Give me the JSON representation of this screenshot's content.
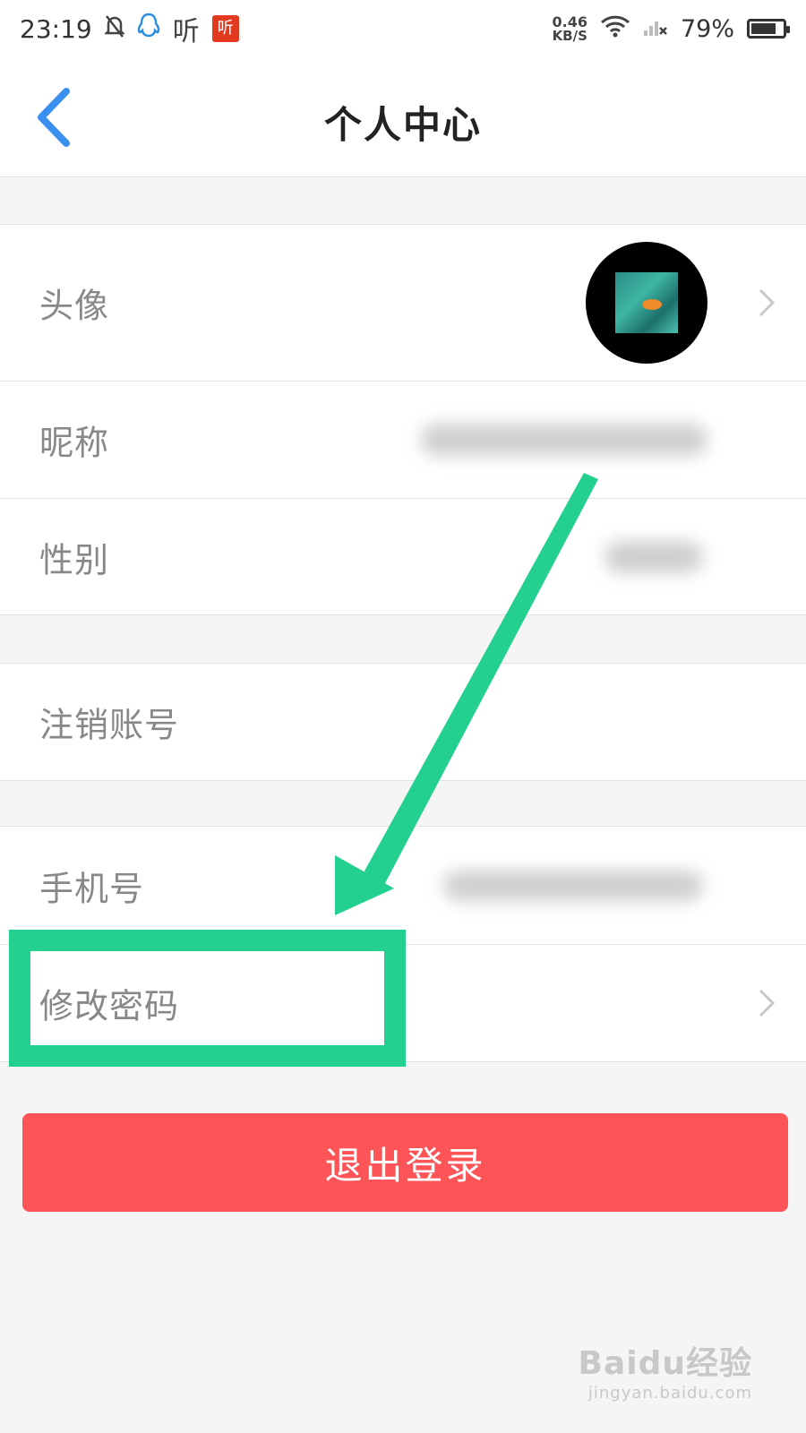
{
  "status_bar": {
    "time": "23:19",
    "ting_label": "听",
    "ting_badge": "听",
    "net_speed_value": "0.46",
    "net_speed_unit": "KB/S",
    "battery_text": "79%",
    "battery_level": 0.79
  },
  "nav": {
    "title": "个人中心"
  },
  "profile_items": [
    {
      "label": "头像"
    },
    {
      "label": "昵称"
    },
    {
      "label": "性别"
    }
  ],
  "account": {
    "cancel_label": "注销账号"
  },
  "security": {
    "phone_label": "手机号",
    "change_password_label": "修改密码"
  },
  "logout_label": "退出登录",
  "annotation": {
    "color": "#23d08f"
  },
  "watermark": {
    "brand": "Baidu经验",
    "url": "jingyan.baidu.com"
  },
  "colors": {
    "accent": "#3b8ff0",
    "danger": "#fc5457"
  }
}
